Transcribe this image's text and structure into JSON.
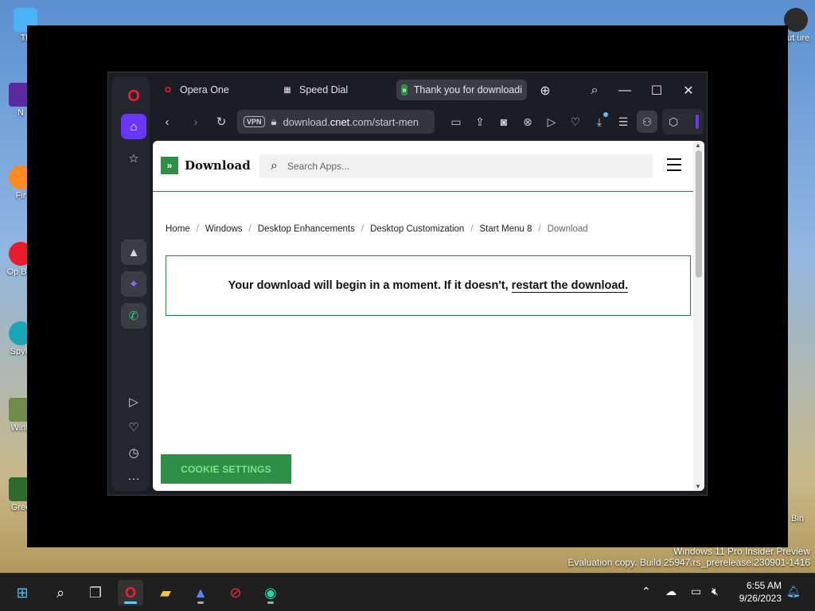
{
  "desktop": {
    "icons": [
      {
        "label": "Th"
      },
      {
        "label": "N"
      },
      {
        "label": "Fir"
      },
      {
        "label": "Op Bro"
      },
      {
        "label": "SpyH"
      },
      {
        "label": "WinL"
      },
      {
        "label": "Gree"
      },
      {
        "label": "out ure"
      },
      {
        "label": "Bin"
      }
    ]
  },
  "browser": {
    "tabs": [
      {
        "label": "Opera One",
        "icon": "opera-logo-icon",
        "color": "#ff1b2d"
      },
      {
        "label": "Speed Dial",
        "icon": "grid-icon"
      },
      {
        "label": "Thank you for downloadi",
        "icon": "download-site-icon",
        "color": "#2f8f46"
      }
    ],
    "address": {
      "vpn": "VPN",
      "pre": "download.",
      "host": "cnet",
      "post": ".com/start-men"
    }
  },
  "page": {
    "logo_text": "Download",
    "search_placeholder": "Search Apps...",
    "breadcrumbs": [
      "Home",
      "Windows",
      "Desktop Enhancements",
      "Desktop Customization",
      "Start Menu 8",
      "Download"
    ],
    "breadcrumb_separator": "/",
    "notice_text": "Your download will begin in a moment. If it doesn't,",
    "notice_link": "restart the download.",
    "cookie_button": "COOKIE SETTINGS"
  },
  "watermark": {
    "line1": "Windows 11 Pro Insider Preview",
    "line2": "Evaluation copy. Build 25947.rs_prerelease.230901-1416"
  },
  "taskbar": {
    "time": "6:55 AM",
    "date": "9/26/2023"
  },
  "colors": {
    "accent": "#6a35ff",
    "site_green": "#2f8f46",
    "opera_red": "#ff1b2d"
  }
}
